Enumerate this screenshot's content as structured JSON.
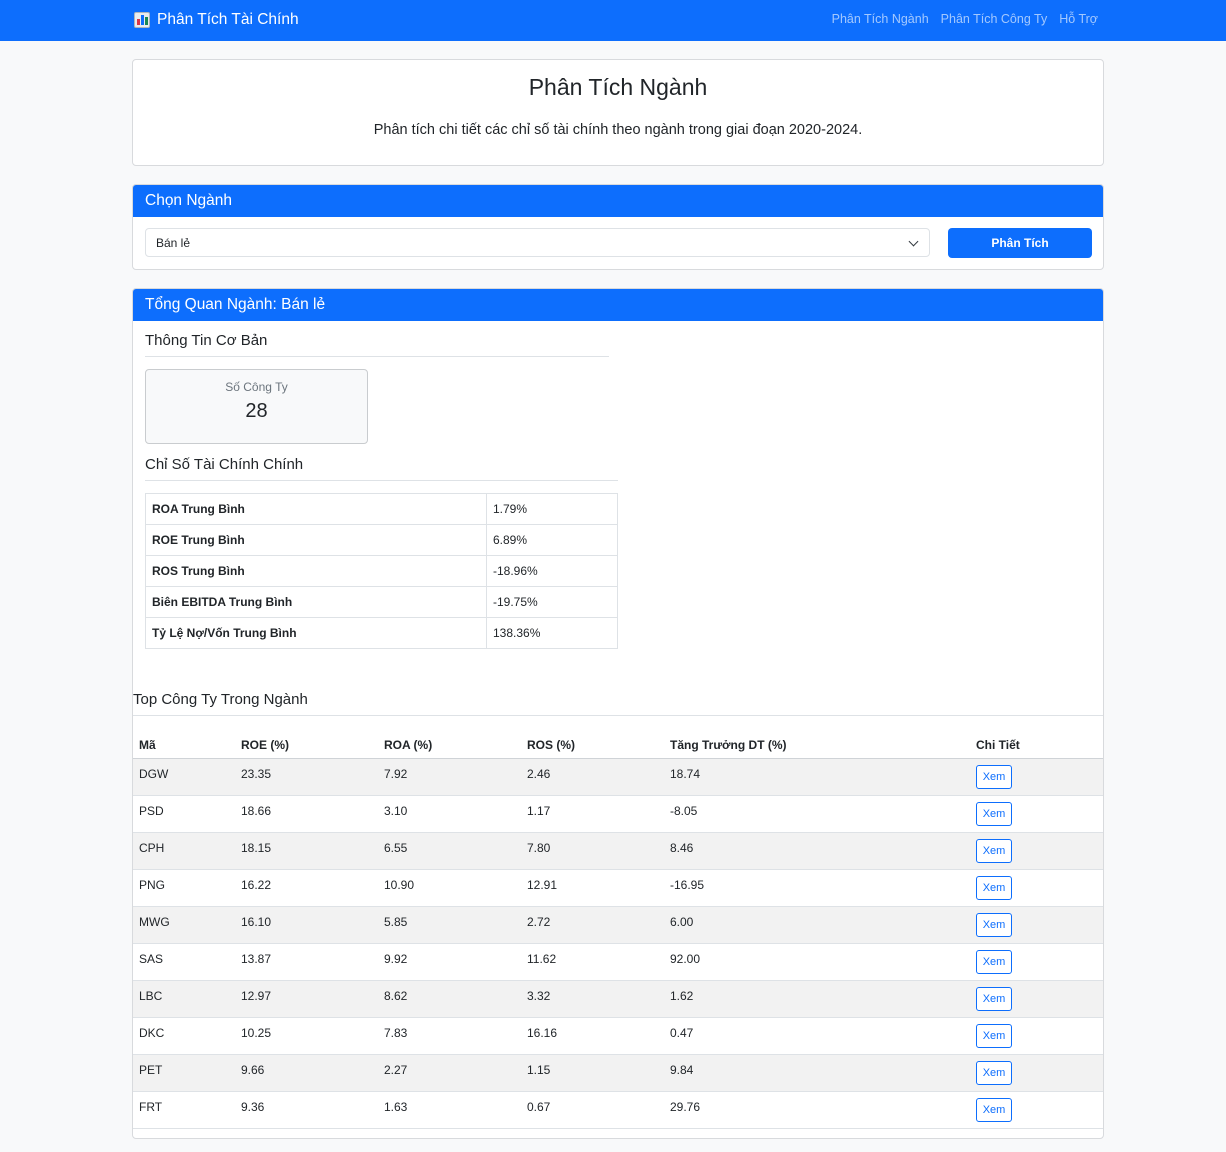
{
  "navbar": {
    "brand": "Phân Tích Tài Chính",
    "brand_icon": "bar-chart-icon",
    "links": [
      "Phân Tích Ngành",
      "Phân Tích Công Ty",
      "Hỗ Trợ"
    ]
  },
  "hero": {
    "title": "Phân Tích Ngành",
    "subtitle": "Phân tích chi tiết các chỉ số tài chính theo ngành trong giai đoạn 2020-2024."
  },
  "selector": {
    "header": "Chọn Ngành",
    "selected": "Bán lẻ",
    "button": "Phân Tích"
  },
  "overview": {
    "header": "Tổng Quan Ngành: Bán lẻ",
    "basic_title": "Thông Tin Cơ Bản",
    "stat_label": "Số Công Ty",
    "stat_value": "28",
    "metrics_title": "Chỉ Số Tài Chính Chính",
    "metrics": [
      {
        "label": "ROA Trung Bình",
        "value": "1.79%"
      },
      {
        "label": "ROE Trung Bình",
        "value": "6.89%"
      },
      {
        "label": "ROS Trung Bình",
        "value": "-18.96%"
      },
      {
        "label": "Biên EBITDA Trung Bình",
        "value": "-19.75%"
      },
      {
        "label": "Tỷ Lệ Nợ/Vốn Trung Bình",
        "value": "138.36%"
      }
    ]
  },
  "top": {
    "title": "Top Công Ty Trong Ngành",
    "headers": [
      "Mã",
      "ROE (%)",
      "ROA (%)",
      "ROS (%)",
      "Tăng Trưởng DT (%)",
      "Chi Tiết"
    ],
    "button_label": "Xem",
    "rows": [
      [
        "DGW",
        "23.35",
        "7.92",
        "2.46",
        "18.74"
      ],
      [
        "PSD",
        "18.66",
        "3.10",
        "1.17",
        "-8.05"
      ],
      [
        "CPH",
        "18.15",
        "6.55",
        "7.80",
        "8.46"
      ],
      [
        "PNG",
        "16.22",
        "10.90",
        "12.91",
        "-16.95"
      ],
      [
        "MWG",
        "16.10",
        "5.85",
        "2.72",
        "6.00"
      ],
      [
        "SAS",
        "13.87",
        "9.92",
        "11.62",
        "92.00"
      ],
      [
        "LBC",
        "12.97",
        "8.62",
        "3.32",
        "1.62"
      ],
      [
        "DKC",
        "10.25",
        "7.83",
        "16.16",
        "0.47"
      ],
      [
        "PET",
        "9.66",
        "2.27",
        "1.15",
        "9.84"
      ],
      [
        "FRT",
        "9.36",
        "1.63",
        "0.67",
        "29.76"
      ]
    ]
  }
}
